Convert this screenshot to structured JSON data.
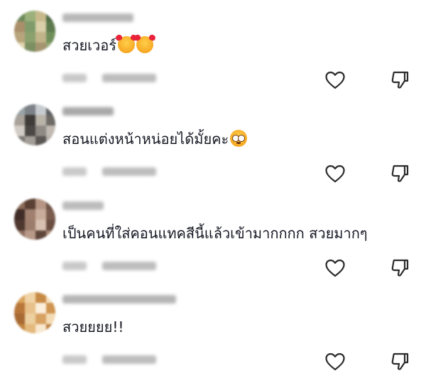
{
  "comments": [
    {
      "username": "",
      "text": "สวยเวอร์",
      "emojis": [
        "smiling-face-with-hearts",
        "smiling-face-with-hearts"
      ],
      "avatar_colors": [
        "#6d8a5c",
        "#9bb07a",
        "#c8b98c",
        "#4e6b45",
        "#a98f6a",
        "#7f9b6b",
        "#d9cfa8",
        "#5d7a4e",
        "#b8a57c",
        "#8aa06d",
        "#c2b48a",
        "#6f8f5a",
        "#e0d6b0",
        "#7c8f62",
        "#a4946f",
        "#93a878"
      ],
      "username_color": "#b8b8b8"
    },
    {
      "username": "",
      "text": "สอนแต่งหน้าหน่อยได้มั้ยคะ",
      "emojis": [
        "flushed-face"
      ],
      "avatar_colors": [
        "#9aa3a8",
        "#7b8186",
        "#c7ccd0",
        "#5c5f62",
        "#a8a29a",
        "#3e3b38",
        "#b9b3aa",
        "#6e6a66",
        "#d2cdc6",
        "#4a4744",
        "#8f8a84",
        "#c0bab2",
        "#7d7975",
        "#a39e97",
        "#5a5754",
        "#b5b0a9"
      ],
      "username_color": "#a9a9a9"
    },
    {
      "username": "",
      "text": "เป็นคนที่ใส่คอนแทคสีนี้แล้วเข้ามากกกก สวยมากๆ",
      "emojis": [],
      "avatar_colors": [
        "#8a6a58",
        "#5a3f33",
        "#b69585",
        "#6e5347",
        "#3f2c26",
        "#a07f6e",
        "#c9ad9c",
        "#7a5c4e",
        "#4d372f",
        "#9c7d6c",
        "#d8c0b0",
        "#6a4e42",
        "#8e6f60",
        "#b89988",
        "#5f463b",
        "#a8897a"
      ],
      "username_color": "#bcbcbc"
    },
    {
      "username": "",
      "text": "สวยยยย!!",
      "emojis": [],
      "avatar_colors": [
        "#d9a55e",
        "#f0d3a6",
        "#c78a45",
        "#f5e1c2",
        "#b9773a",
        "#e8c089",
        "#fbeedb",
        "#cf9550",
        "#a86a33",
        "#edd0a0",
        "#d7a162",
        "#f3dbb5",
        "#c1843f",
        "#e4b97d",
        "#f8e8d0",
        "#bd7d3c"
      ],
      "username_color": "#b5b5b5"
    }
  ]
}
